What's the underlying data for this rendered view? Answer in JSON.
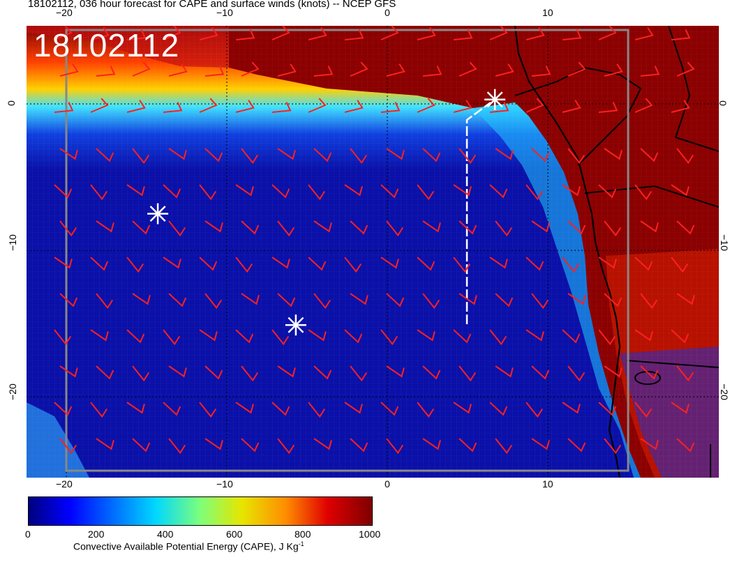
{
  "title": "18102112, 036 hour forecast for CAPE and surface winds (knots) -- NCEP GFS",
  "stamp": "18102112",
  "axes": {
    "x_ticks": [
      "−20",
      "−10",
      "0",
      "10"
    ],
    "y_ticks_left": [
      "0",
      "−10",
      "−20"
    ],
    "y_ticks_right": [
      "0",
      "−10",
      "−20"
    ]
  },
  "colorbar": {
    "ticks": [
      "0",
      "200",
      "400",
      "600",
      "800",
      "1000"
    ],
    "caption": "Convective Available Potential Energy (CAPE), J Kg",
    "caption_sup": "-1",
    "colors": [
      "#00007f",
      "#0000ff",
      "#0070ff",
      "#00d8ff",
      "#7dff7a",
      "#e6e600",
      "#ff8c00",
      "#e00000",
      "#7f0000"
    ]
  },
  "colors": {
    "ocean": "#1a1ab0",
    "land_high_cape": "#8b0000",
    "wind_barb": "#ff2020",
    "coast": "#000000",
    "track": "#ffffff"
  },
  "markers": [
    {
      "name": "star-1",
      "lon": -14.3,
      "lat": -7.5
    },
    {
      "name": "star-2",
      "lon": -5.7,
      "lat": -15.1
    },
    {
      "name": "star-3",
      "lon": 6.7,
      "lat": 0.3
    }
  ]
}
